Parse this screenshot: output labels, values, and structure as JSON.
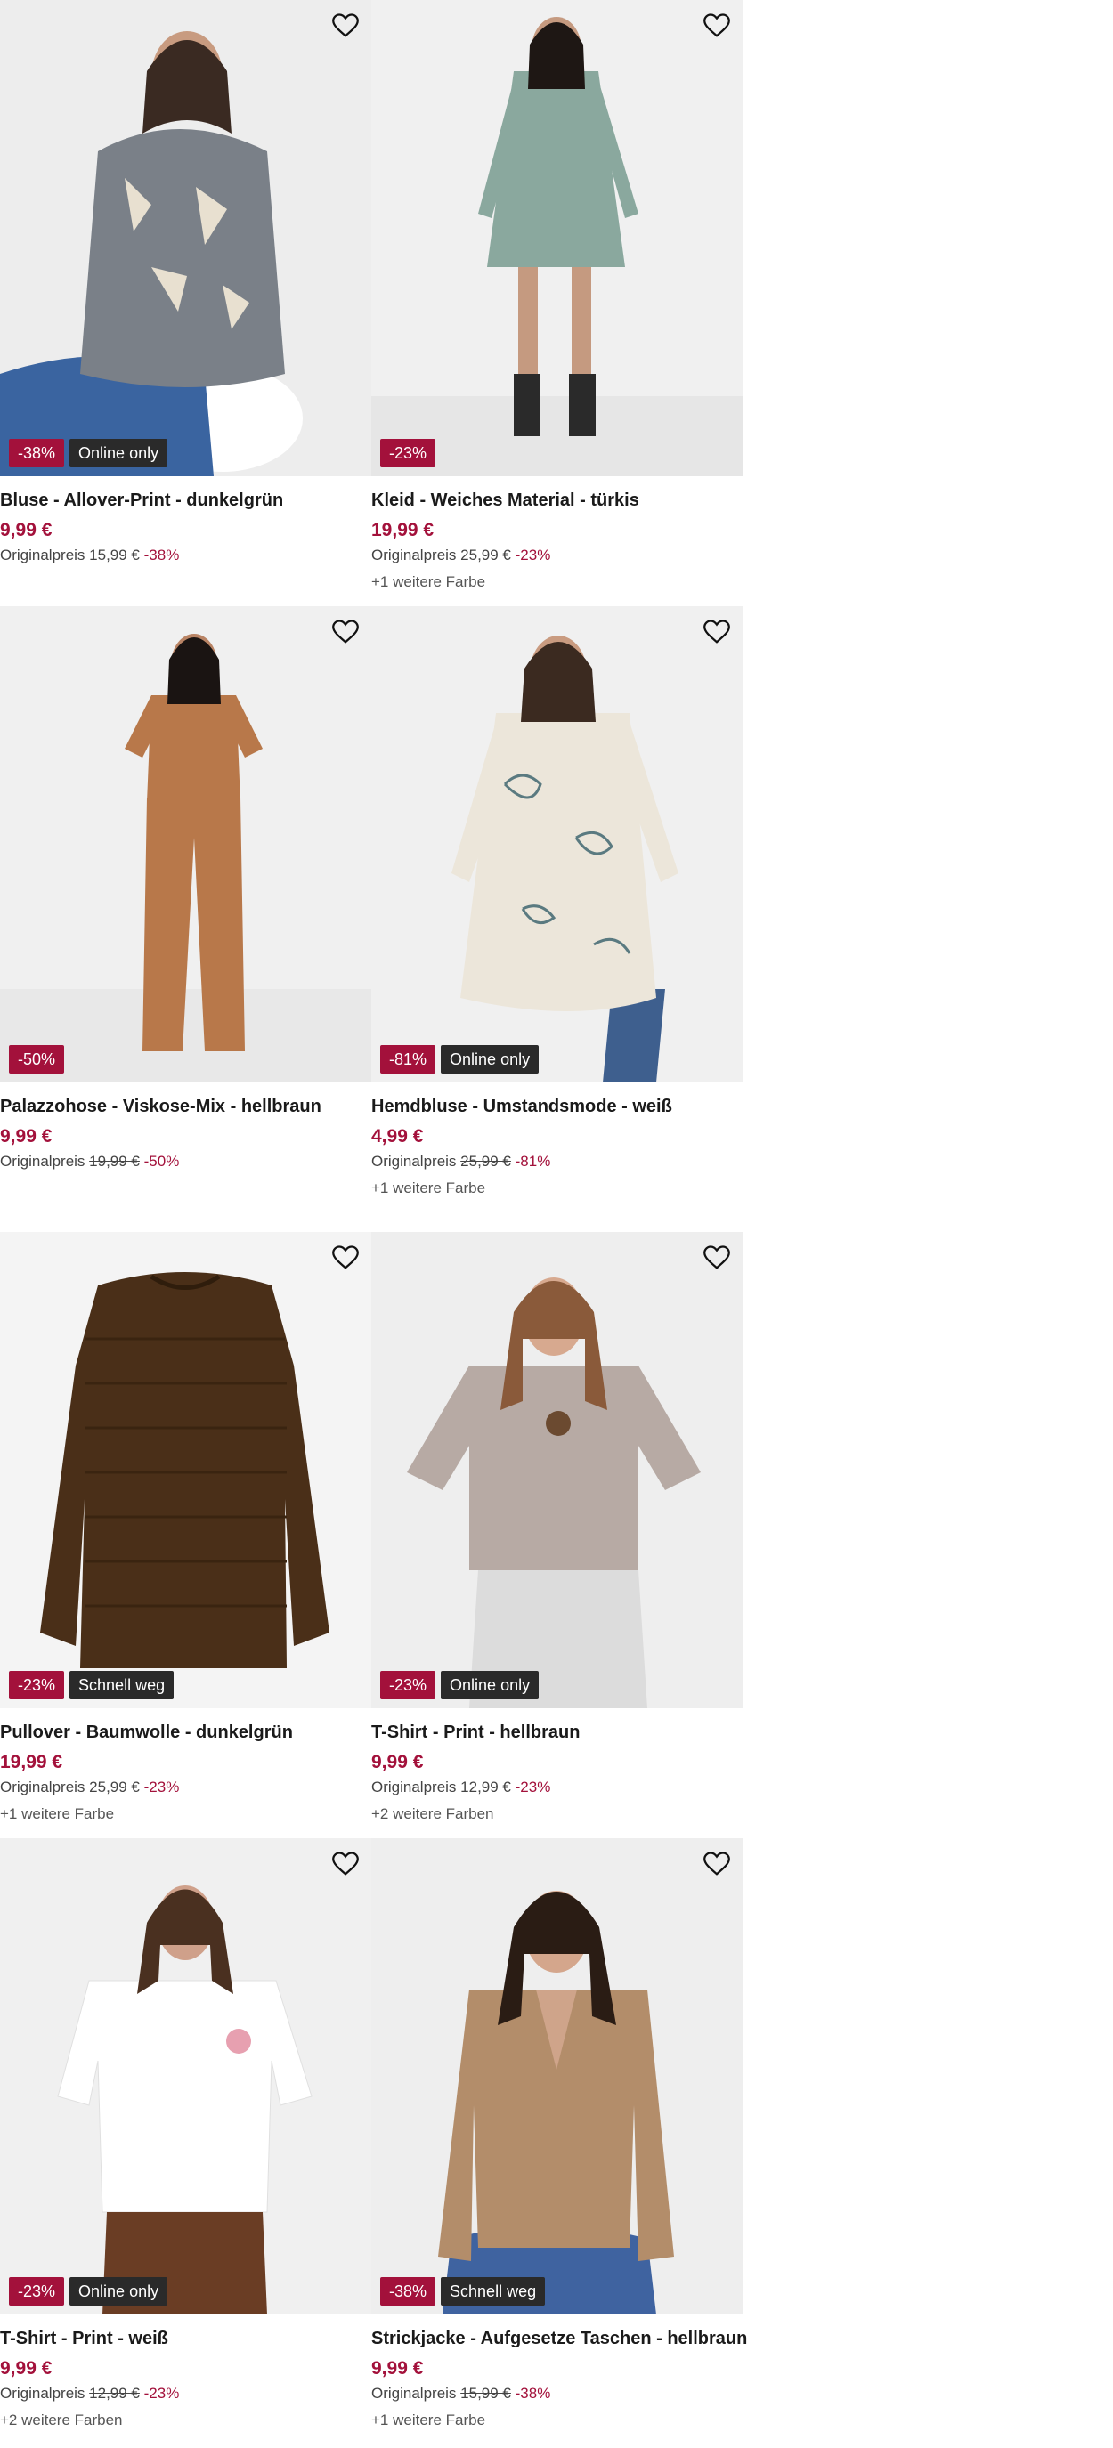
{
  "colors": {
    "accent": "#a3113b",
    "tag_bg": "#2a2a2a",
    "image_bg": "#efefef"
  },
  "products": [
    {
      "title": "Bluse - Allover-Print - dunkelgrün",
      "price": "9,99 €",
      "orig_label": "Originalpreis",
      "orig_price": "15,99 €",
      "orig_pct": "-38%",
      "discount": "-38%",
      "tag": "Online only",
      "more_colors": ""
    },
    {
      "title": "Kleid - Weiches Material - türkis",
      "price": "19,99 €",
      "orig_label": "Originalpreis",
      "orig_price": "25,99 €",
      "orig_pct": "-23%",
      "discount": "-23%",
      "tag": "",
      "more_colors": "+1 weitere Farbe"
    },
    {
      "title": "Palazzohose - Viskose-Mix - hellbraun",
      "price": "9,99 €",
      "orig_label": "Originalpreis",
      "orig_price": "19,99 €",
      "orig_pct": "-50%",
      "discount": "-50%",
      "tag": "",
      "more_colors": ""
    },
    {
      "title": "Hemdbluse - Umstandsmode - weiß",
      "price": "4,99 €",
      "orig_label": "Originalpreis",
      "orig_price": "25,99 €",
      "orig_pct": "-81%",
      "discount": "-81%",
      "tag": "Online only",
      "more_colors": "+1 weitere Farbe"
    },
    {
      "title": "Pullover - Baumwolle - dunkelgrün",
      "price": "19,99 €",
      "orig_label": "Originalpreis",
      "orig_price": "25,99 €",
      "orig_pct": "-23%",
      "discount": "-23%",
      "tag": "Schnell weg",
      "more_colors": "+1 weitere Farbe"
    },
    {
      "title": "T-Shirt - Print - hellbraun",
      "price": "9,99 €",
      "orig_label": "Originalpreis",
      "orig_price": "12,99 €",
      "orig_pct": "-23%",
      "discount": "-23%",
      "tag": "Online only",
      "more_colors": "+2 weitere Farben"
    },
    {
      "title": "T-Shirt - Print - weiß",
      "price": "9,99 €",
      "orig_label": "Originalpreis",
      "orig_price": "12,99 €",
      "orig_pct": "-23%",
      "discount": "-23%",
      "tag": "Online only",
      "more_colors": "+2 weitere Farben"
    },
    {
      "title": "Strickjacke - Aufgesetze Taschen - hellbraun",
      "price": "9,99 €",
      "orig_label": "Originalpreis",
      "orig_price": "15,99 €",
      "orig_pct": "-38%",
      "discount": "-38%",
      "tag": "Schnell weg",
      "more_colors": "+1 weitere Farbe"
    }
  ],
  "icons": {
    "favorite": "heart-outline-icon"
  }
}
